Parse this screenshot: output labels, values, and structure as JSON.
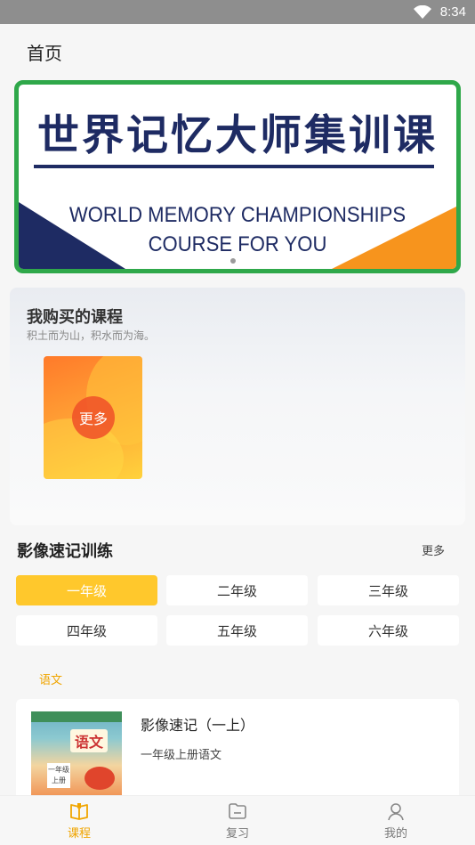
{
  "status_bar": {
    "time": "8:34"
  },
  "page": {
    "title": "首页"
  },
  "banner": {
    "title_cn": "世界记忆大师集训课",
    "title_en_line1": "WORLD MEMORY CHAMPIONSHIPS",
    "title_en_line2": "COURSE FOR YOU",
    "border_color": "#2fa84a",
    "text_color": "#1e2b63",
    "accent_color": "#f7941d"
  },
  "purchased": {
    "title": "我购买的课程",
    "subtitle": "积土而为山，积水而为海。",
    "more_label": "更多"
  },
  "training": {
    "title": "影像速记训练",
    "more_label": "更多",
    "grades": [
      "一年级",
      "二年级",
      "三年级",
      "四年级",
      "五年级",
      "六年级"
    ],
    "selected_grade": "一年级",
    "accent_color": "#ffc82c"
  },
  "subject": {
    "label": "语文"
  },
  "course": {
    "title": "影像速记（一上）",
    "description": "一年级上册语文",
    "cover_title": "语文",
    "cover_grade": "一年级",
    "cover_term": "上册"
  },
  "bottom_nav": {
    "items": [
      {
        "label": "课程",
        "icon": "book-icon"
      },
      {
        "label": "复习",
        "icon": "folder-icon"
      },
      {
        "label": "我的",
        "icon": "user-icon"
      }
    ],
    "active": "课程",
    "active_color": "#f0a500"
  }
}
